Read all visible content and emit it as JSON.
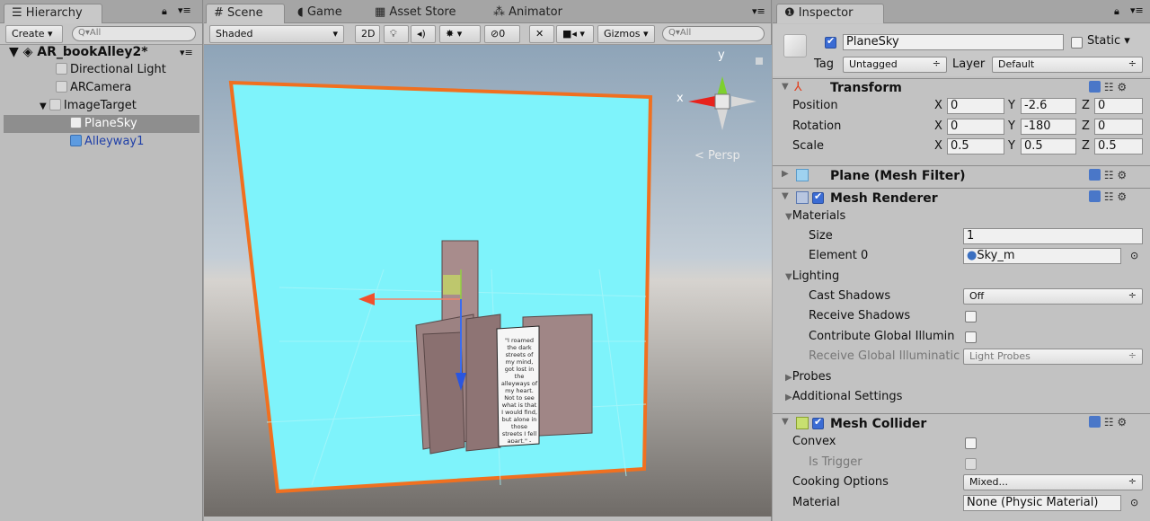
{
  "hierarchy": {
    "tab_label": "Hierarchy",
    "create_label": "Create",
    "search_placeholder": "All",
    "scene_name": "AR_bookAlley2*",
    "items": [
      {
        "label": "Directional Light"
      },
      {
        "label": "ARCamera"
      },
      {
        "label": "ImageTarget"
      },
      {
        "label": "PlaneSky"
      },
      {
        "label": "Alleyway1"
      }
    ]
  },
  "tabs": [
    {
      "label": "Scene"
    },
    {
      "label": "Game"
    },
    {
      "label": "Asset Store"
    },
    {
      "label": "Animator"
    }
  ],
  "scene_toolbar": {
    "shading": "Shaded",
    "mode_2d": "2D",
    "hidden_count": "0",
    "gizmos": "Gizmos",
    "search_placeholder": "All",
    "persp_label": "Persp",
    "gizmo_axes": {
      "x": "x",
      "y": "y"
    }
  },
  "note": {
    "text": "\"I roamed the dark streets of my mind, got lost in the alleyways of my heart. Not to see what is that I would find, but alone in those streets I fell apart.\" -Natalia Crow"
  },
  "inspector": {
    "tab_label": "Inspector",
    "object_name": "PlaneSky",
    "static_label": "Static",
    "tag_label": "Tag",
    "tag_value": "Untagged",
    "layer_label": "Layer",
    "layer_value": "Default",
    "transform": {
      "title": "Transform",
      "position_label": "Position",
      "rotation_label": "Rotation",
      "scale_label": "Scale",
      "position": {
        "x": "0",
        "y": "-2.6",
        "z": "0"
      },
      "rotation": {
        "x": "0",
        "y": "-180",
        "z": "0"
      },
      "scale": {
        "x": "0.5",
        "y": "0.5",
        "z": "0.5"
      },
      "axis_x": "X",
      "axis_y": "Y",
      "axis_z": "Z"
    },
    "mesh_filter": {
      "title": "Plane (Mesh Filter)"
    },
    "mesh_renderer": {
      "title": "Mesh Renderer",
      "materials_label": "Materials",
      "size_label": "Size",
      "size_value": "1",
      "element0_label": "Element 0",
      "element0_value": "Sky_m",
      "lighting_label": "Lighting",
      "cast_shadows_label": "Cast Shadows",
      "cast_shadows_value": "Off",
      "receive_shadows_label": "Receive Shadows",
      "contribute_gi_label": "Contribute Global Illumin",
      "receive_gi_label": "Receive Global Illuminatic",
      "receive_gi_value": "Light Probes",
      "probes_label": "Probes",
      "additional_label": "Additional Settings"
    },
    "mesh_collider": {
      "title": "Mesh Collider",
      "convex_label": "Convex",
      "is_trigger_label": "Is Trigger",
      "cooking_label": "Cooking Options",
      "cooking_value": "Mixed...",
      "material_label": "Material",
      "material_value": "None (Physic Material)"
    }
  }
}
